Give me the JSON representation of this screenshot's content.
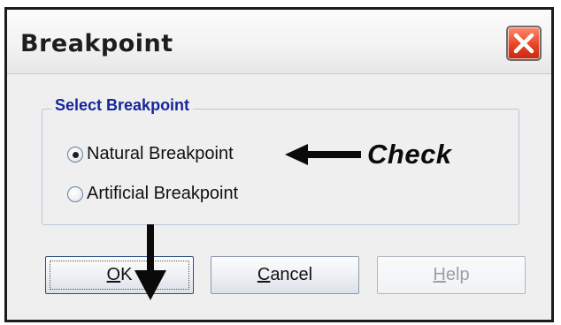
{
  "dialog": {
    "title": "Breakpoint"
  },
  "group": {
    "title": "Select Breakpoint",
    "options": [
      {
        "label": "Natural Breakpoint",
        "selected": true
      },
      {
        "label": "Artificial Breakpoint",
        "selected": false
      }
    ]
  },
  "annotation": {
    "check_text": "Check"
  },
  "buttons": {
    "ok": {
      "mnemonic": "O",
      "rest": "K"
    },
    "cancel": {
      "mnemonic": "C",
      "rest": "ancel"
    },
    "help": {
      "mnemonic": "H",
      "rest": "elp",
      "disabled": true
    }
  },
  "icons": {
    "close": "close-x-icon",
    "radio": "radio-button-icon",
    "arrow_left": "left-arrow-icon",
    "arrow_down": "down-arrow-icon"
  },
  "colors": {
    "group_title": "#15279a",
    "close_button": "#e84525"
  }
}
